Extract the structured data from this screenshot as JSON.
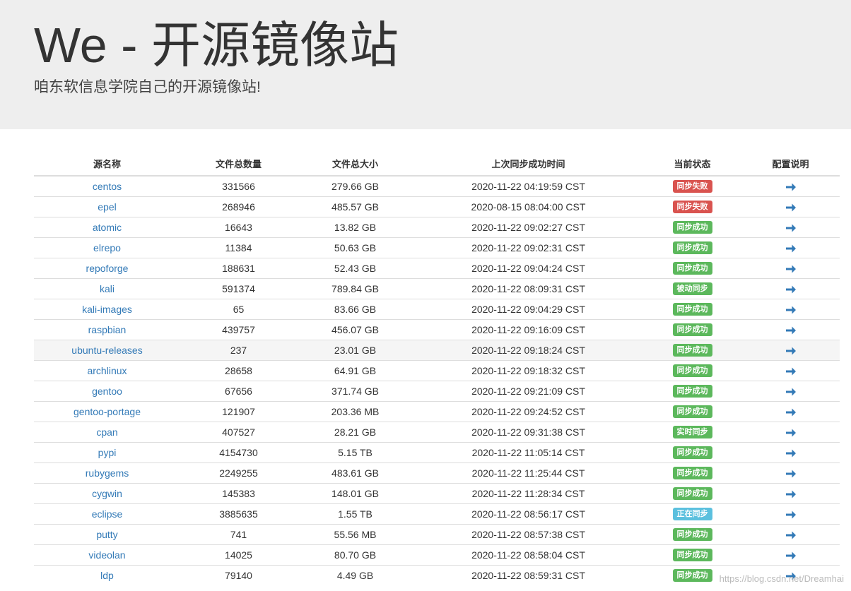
{
  "header": {
    "title": "We - 开源镜像站",
    "subtitle": "咱东软信息学院自己的开源镜像站!"
  },
  "table": {
    "columns": [
      "源名称",
      "文件总数量",
      "文件总大小",
      "上次同步成功时间",
      "当前状态",
      "配置说明"
    ],
    "rows": [
      {
        "name": "centos",
        "count": "331566",
        "size": "279.66 GB",
        "time": "2020-11-22 04:19:59 CST",
        "status": "同步失败",
        "status_type": "danger"
      },
      {
        "name": "epel",
        "count": "268946",
        "size": "485.57 GB",
        "time": "2020-08-15 08:04:00 CST",
        "status": "同步失败",
        "status_type": "danger"
      },
      {
        "name": "atomic",
        "count": "16643",
        "size": "13.82 GB",
        "time": "2020-11-22 09:02:27 CST",
        "status": "同步成功",
        "status_type": "success"
      },
      {
        "name": "elrepo",
        "count": "11384",
        "size": "50.63 GB",
        "time": "2020-11-22 09:02:31 CST",
        "status": "同步成功",
        "status_type": "success"
      },
      {
        "name": "repoforge",
        "count": "188631",
        "size": "52.43 GB",
        "time": "2020-11-22 09:04:24 CST",
        "status": "同步成功",
        "status_type": "success"
      },
      {
        "name": "kali",
        "count": "591374",
        "size": "789.84 GB",
        "time": "2020-11-22 08:09:31 CST",
        "status": "被动同步",
        "status_type": "success"
      },
      {
        "name": "kali-images",
        "count": "65",
        "size": "83.66 GB",
        "time": "2020-11-22 09:04:29 CST",
        "status": "同步成功",
        "status_type": "success"
      },
      {
        "name": "raspbian",
        "count": "439757",
        "size": "456.07 GB",
        "time": "2020-11-22 09:16:09 CST",
        "status": "同步成功",
        "status_type": "success"
      },
      {
        "name": "ubuntu-releases",
        "count": "237",
        "size": "23.01 GB",
        "time": "2020-11-22 09:18:24 CST",
        "status": "同步成功",
        "status_type": "success"
      },
      {
        "name": "archlinux",
        "count": "28658",
        "size": "64.91 GB",
        "time": "2020-11-22 09:18:32 CST",
        "status": "同步成功",
        "status_type": "success"
      },
      {
        "name": "gentoo",
        "count": "67656",
        "size": "371.74 GB",
        "time": "2020-11-22 09:21:09 CST",
        "status": "同步成功",
        "status_type": "success"
      },
      {
        "name": "gentoo-portage",
        "count": "121907",
        "size": "203.36 MB",
        "time": "2020-11-22 09:24:52 CST",
        "status": "同步成功",
        "status_type": "success"
      },
      {
        "name": "cpan",
        "count": "407527",
        "size": "28.21 GB",
        "time": "2020-11-22 09:31:38 CST",
        "status": "实时同步",
        "status_type": "success"
      },
      {
        "name": "pypi",
        "count": "4154730",
        "size": "5.15 TB",
        "time": "2020-11-22 11:05:14 CST",
        "status": "同步成功",
        "status_type": "success"
      },
      {
        "name": "rubygems",
        "count": "2249255",
        "size": "483.61 GB",
        "time": "2020-11-22 11:25:44 CST",
        "status": "同步成功",
        "status_type": "success"
      },
      {
        "name": "cygwin",
        "count": "145383",
        "size": "148.01 GB",
        "time": "2020-11-22 11:28:34 CST",
        "status": "同步成功",
        "status_type": "success"
      },
      {
        "name": "eclipse",
        "count": "3885635",
        "size": "1.55 TB",
        "time": "2020-11-22 08:56:17 CST",
        "status": "正在同步",
        "status_type": "info"
      },
      {
        "name": "putty",
        "count": "741",
        "size": "55.56 MB",
        "time": "2020-11-22 08:57:38 CST",
        "status": "同步成功",
        "status_type": "success"
      },
      {
        "name": "videolan",
        "count": "14025",
        "size": "80.70 GB",
        "time": "2020-11-22 08:58:04 CST",
        "status": "同步成功",
        "status_type": "success"
      },
      {
        "name": "ldp",
        "count": "79140",
        "size": "4.49 GB",
        "time": "2020-11-22 08:59:31 CST",
        "status": "同步成功",
        "status_type": "success"
      }
    ],
    "hover_row_index": 8
  },
  "icons": {
    "config_link": "arrow-right-icon"
  },
  "colors": {
    "link": "#337ab7",
    "danger": "#d9534f",
    "success": "#5cb85c",
    "info": "#5bc0de",
    "jumbotron_bg": "#eeeeee",
    "arrow": "#337ab7"
  },
  "watermark": "https://blog.csdn.net/Dreamhai"
}
